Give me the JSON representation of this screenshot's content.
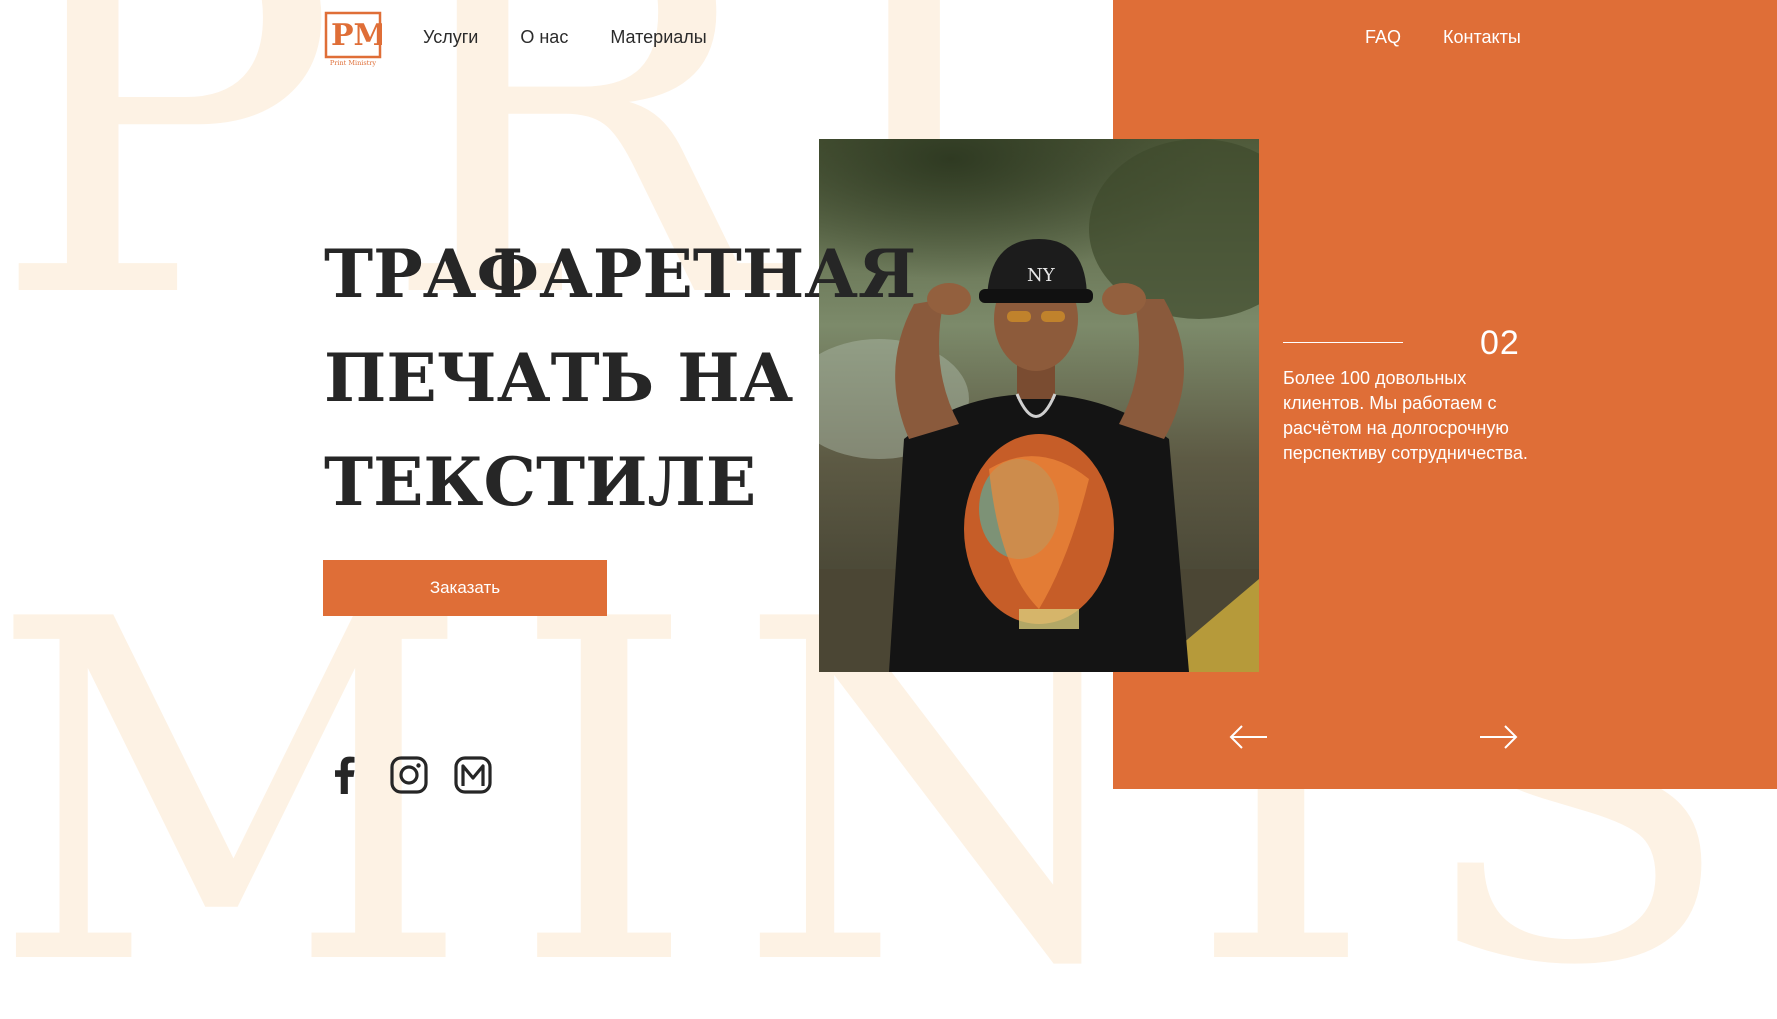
{
  "background": {
    "top_word": "PRINT",
    "bottom_word": "MINISTRY"
  },
  "brand": {
    "logo_letters": "PM",
    "logo_caption": "Print Ministry",
    "accent_color": "#df6e37"
  },
  "nav_left": [
    {
      "label": "Услуги"
    },
    {
      "label": "О нас"
    },
    {
      "label": "Материалы"
    }
  ],
  "nav_right": [
    {
      "label": "FAQ"
    },
    {
      "label": "Контакты"
    }
  ],
  "hero": {
    "title_lines": [
      "Трафаретная",
      "печать на",
      "текстиле"
    ],
    "order_button": "Заказать"
  },
  "socials": [
    {
      "icon": "facebook-icon"
    },
    {
      "icon": "instagram-icon"
    },
    {
      "icon": "mail-icon"
    }
  ],
  "slide": {
    "number": "02",
    "text": "Более 100 довольных клиентов. Мы работаем с расчётом на долгосрочную перспективу сотрудничества."
  }
}
